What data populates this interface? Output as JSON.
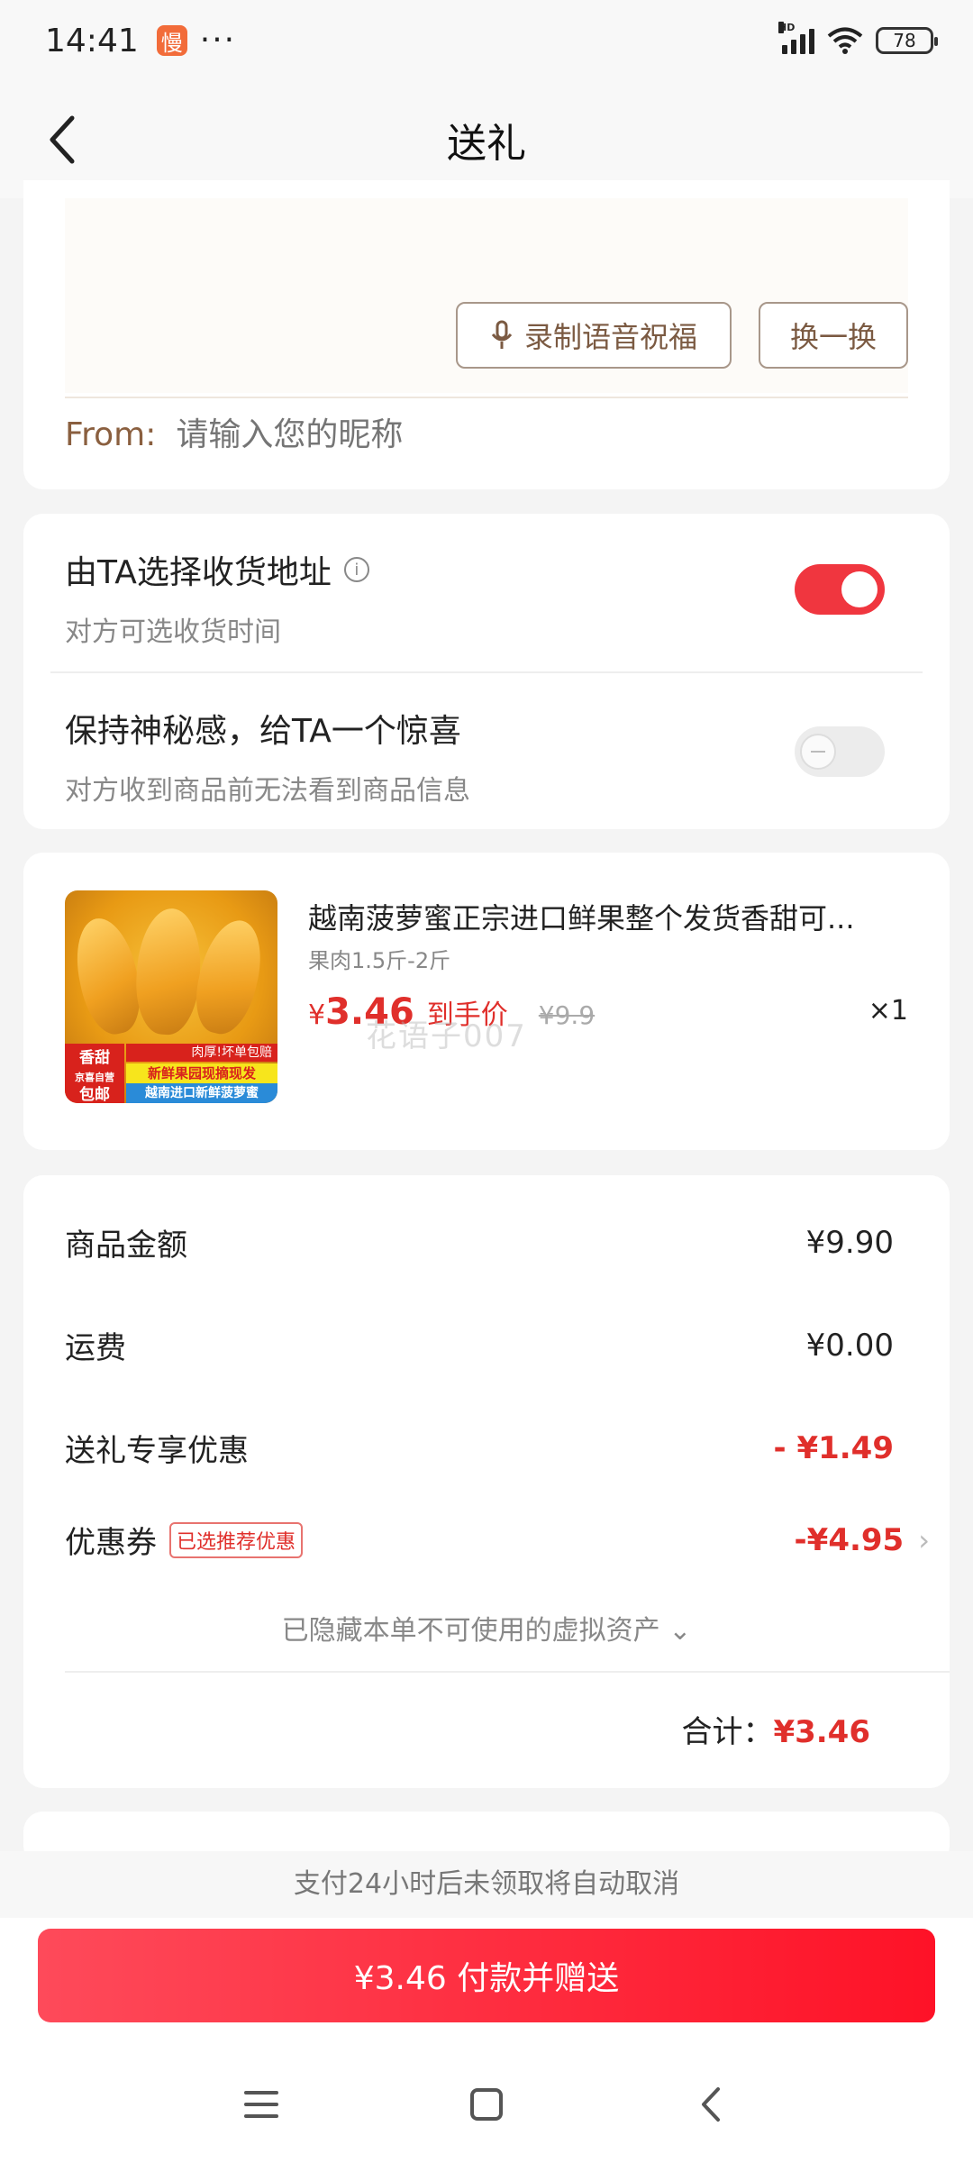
{
  "status": {
    "time": "14:41",
    "app_badge": "慢",
    "dots": "···",
    "hd": "HD",
    "battery": "78"
  },
  "nav": {
    "title": "送礼"
  },
  "message": {
    "voice_button": "录制语音祝福",
    "change_button": "换一换",
    "from_label": "From:",
    "from_placeholder": "请输入您的昵称"
  },
  "options": {
    "address": {
      "title": "由TA选择收货地址",
      "subtitle": "对方可选收货时间",
      "enabled": true
    },
    "mystery": {
      "title": "保持神秘感，给TA一个惊喜",
      "subtitle": "对方收到商品前无法看到商品信息",
      "enabled": false
    }
  },
  "product": {
    "title": "越南菠萝蜜正宗进口鲜果整个发货香甜可...",
    "spec": "果肉1.5斤-2斤",
    "price_symbol": "¥",
    "price": "3.46",
    "price_tag": "到手价",
    "original_price": "¥9.9",
    "quantity": "×1",
    "watermark": "花语子007",
    "image_tags": {
      "red_tag": "香甜\n京喜自营\n包邮",
      "strip1": "肉厚!坏单包赔",
      "strip2": "新鲜果园现摘现发",
      "strip3": "越南进口新鲜菠萝蜜"
    }
  },
  "summary": {
    "rows": [
      {
        "label": "商品金额",
        "value": "¥9.90"
      },
      {
        "label": "运费",
        "value": "¥0.00"
      },
      {
        "label": "送礼专享优惠",
        "value": "- ¥1.49"
      },
      {
        "label": "优惠券",
        "tag": "已选推荐优惠",
        "value": "-¥4.95"
      }
    ],
    "hidden_assets": "已隐藏本单不可使用的虚拟资产 ⌄",
    "total_label": "合计：",
    "total_value": "¥3.46"
  },
  "footer": {
    "notice": "支付24小时后未领取将自动取消",
    "pay_button": "¥3.46 付款并赠送"
  },
  "colors": {
    "accent": "#f0363f",
    "brown": "#8a5f3f",
    "price_red": "#e02f2b"
  }
}
